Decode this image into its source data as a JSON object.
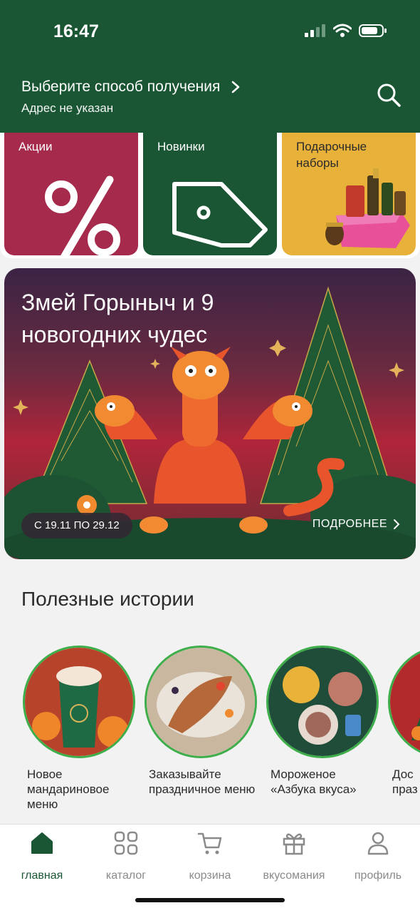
{
  "status": {
    "time": "16:47"
  },
  "header": {
    "title": "Выберите способ получения",
    "subtitle": "Адрес не указан",
    "search_icon": "search-icon"
  },
  "categories": [
    {
      "label": "Акции",
      "icon": "percent-icon",
      "color": "#a52a4c"
    },
    {
      "label": "Новинки",
      "icon": "tag-icon",
      "color": "#1a5634"
    },
    {
      "label": "Подарочные\nнаборы",
      "icon": "gift-box-image",
      "color": "#e8b23a"
    }
  ],
  "banner": {
    "title": "Змей Горыныч и 9 новогодних чудес",
    "dates": "С 19.11 ПО 29.12",
    "more": "ПОДРОБНЕЕ"
  },
  "stories": {
    "title": "Полезные истории",
    "items": [
      {
        "label": "Новое мандариновое меню"
      },
      {
        "label": "Заказывайте праздничное меню"
      },
      {
        "label": "Мороженое «Азбука вкуса»"
      },
      {
        "label": "Дос\nпраз"
      }
    ]
  },
  "tabbar": {
    "items": [
      {
        "label": "главная",
        "icon": "home-icon"
      },
      {
        "label": "каталог",
        "icon": "grid-icon"
      },
      {
        "label": "корзина",
        "icon": "cart-icon"
      },
      {
        "label": "вкусомания",
        "icon": "gift-icon"
      },
      {
        "label": "профиль",
        "icon": "profile-icon"
      }
    ],
    "active": "главная"
  },
  "colors": {
    "brand_green": "#1a5634",
    "accent_green": "#3dae4a",
    "promo_red": "#a52a4c",
    "gift_yellow": "#e8b23a"
  }
}
